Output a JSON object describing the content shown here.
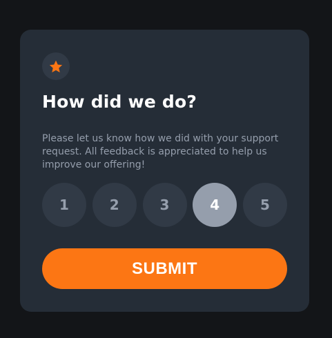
{
  "card": {
    "title": "How did we do?",
    "description": "Please let us know how we did with your support request. All feedback is appreciated to help us improve our offering!",
    "ratings": [
      "1",
      "2",
      "3",
      "4",
      "5"
    ],
    "selected_rating": "4",
    "submit_label": "SUBMIT"
  },
  "icons": {
    "badge": "star-icon"
  },
  "colors": {
    "page_background": "#131518",
    "card_background": "#252d37",
    "accent": "#fc7614",
    "rating_background": "#313a46",
    "rating_selected_background": "#959eac",
    "text_muted": "#959eac",
    "text_white": "#ffffff"
  }
}
